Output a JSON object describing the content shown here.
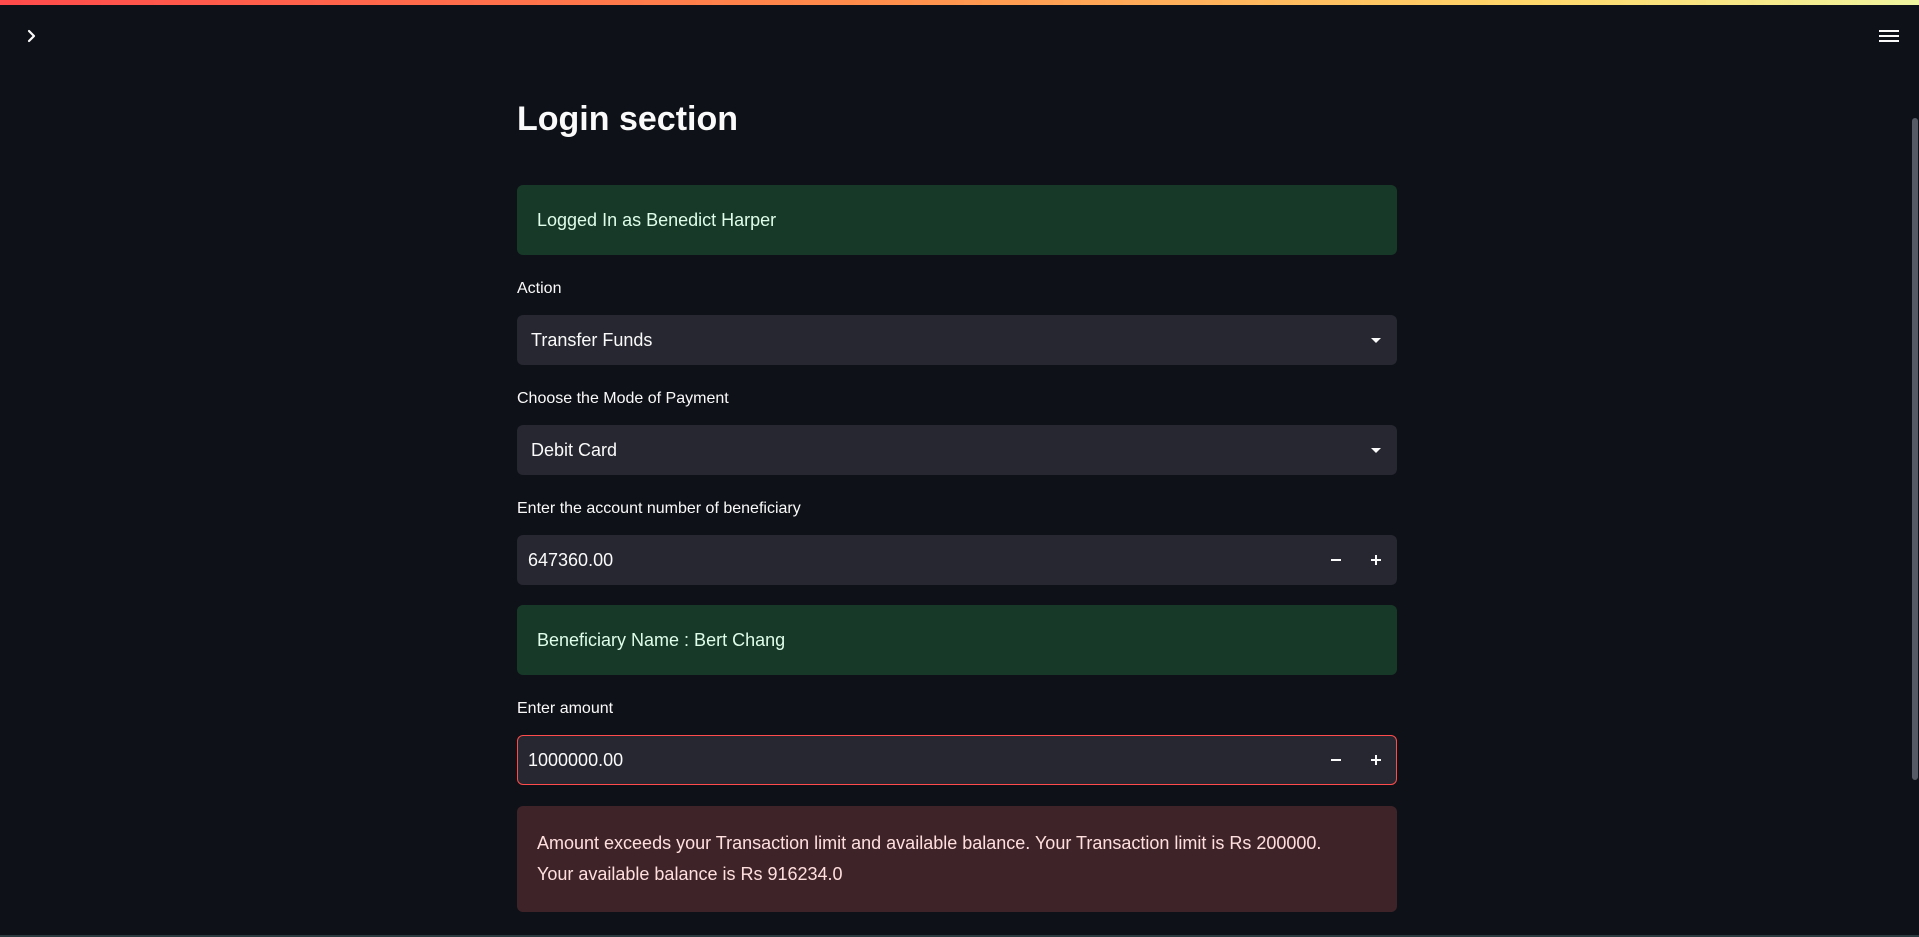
{
  "page": {
    "title": "Login section"
  },
  "login_status": {
    "text": "Logged In as Benedict Harper"
  },
  "action_field": {
    "label": "Action",
    "selected": "Transfer Funds"
  },
  "payment_mode_field": {
    "label": "Choose the Mode of Payment",
    "selected": "Debit Card"
  },
  "account_field": {
    "label": "Enter the account number of beneficiary",
    "value": "647360.00"
  },
  "beneficiary_status": {
    "text": "Beneficiary Name : Bert Chang"
  },
  "amount_field": {
    "label": "Enter amount",
    "value": "1000000.00"
  },
  "error_message": {
    "line1": "Amount exceeds your Transaction limit and available balance. Your Transaction limit is Rs 200000.",
    "line2": "Your available balance is Rs 916234.0"
  },
  "icons": {
    "sidebar_toggle": "chevron-right-icon",
    "menu": "hamburger-menu-icon",
    "dropdown": "caret-down-icon",
    "decrement": "minus-icon",
    "increment": "plus-icon"
  },
  "colors": {
    "background": "#0e1117",
    "input_background": "#262730",
    "success_background": "#173928",
    "success_text": "#dffde9",
    "error_background": "#3e2428",
    "error_text": "#ffdede",
    "error_border": "#ff4b4b"
  }
}
